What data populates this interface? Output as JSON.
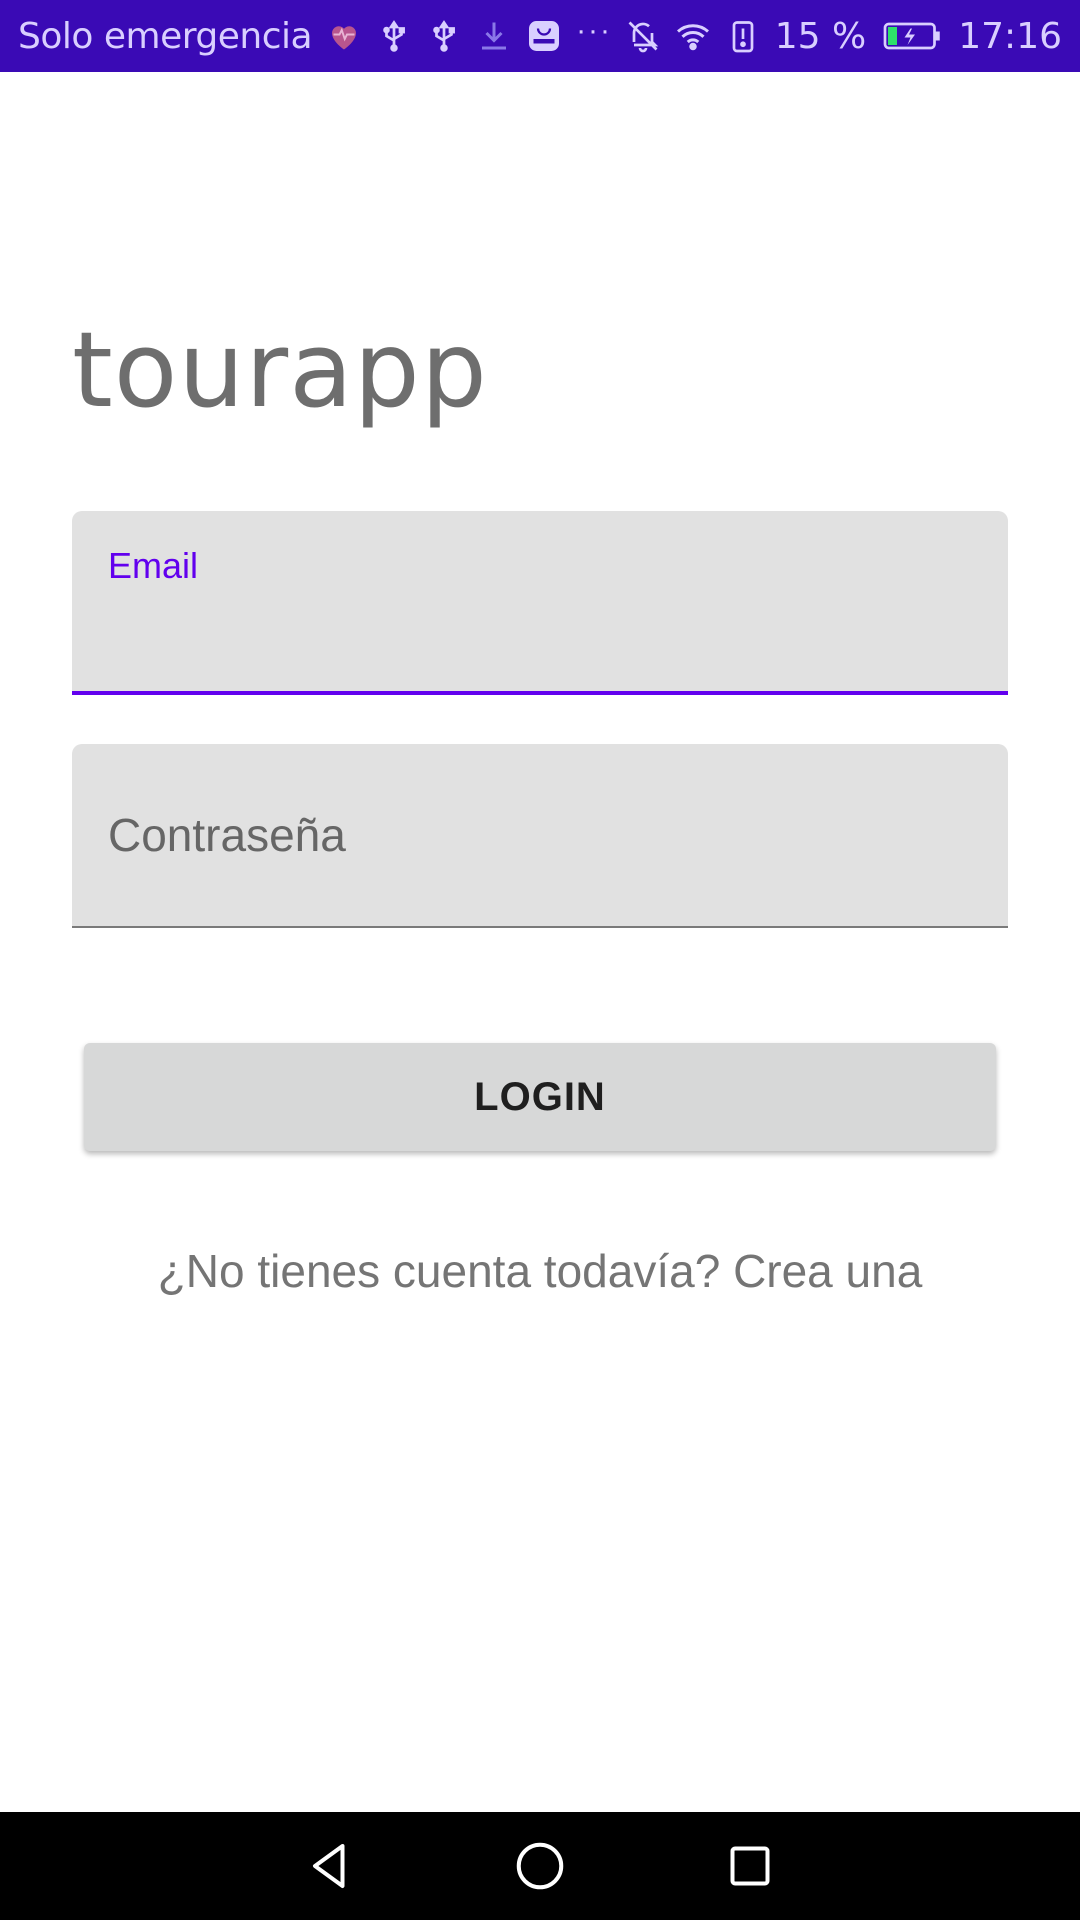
{
  "status_bar": {
    "carrier": "Solo emergencia",
    "battery_percent": "15 %",
    "time": "17:16",
    "background": "#3a0ab5",
    "icons_left": [
      "heart-icon",
      "usb-icon",
      "usb-icon",
      "download-icon",
      "huawei-store-icon",
      "more-dots-icon"
    ],
    "icons_right": [
      "mute-icon",
      "wifi-icon",
      "battery-alert-icon",
      "battery-charging-icon"
    ],
    "dots": "···"
  },
  "app": {
    "title": "tourapp"
  },
  "form": {
    "email": {
      "label": "Email",
      "value": "",
      "focused": true,
      "accent": "#6200ee"
    },
    "password": {
      "label": "Contraseña",
      "value": ""
    },
    "login_label": "LOGIN",
    "signup_text": "¿No tienes cuenta todavía? Crea una"
  },
  "nav_bar": {
    "buttons": [
      "back-icon",
      "home-icon",
      "recents-icon"
    ]
  }
}
